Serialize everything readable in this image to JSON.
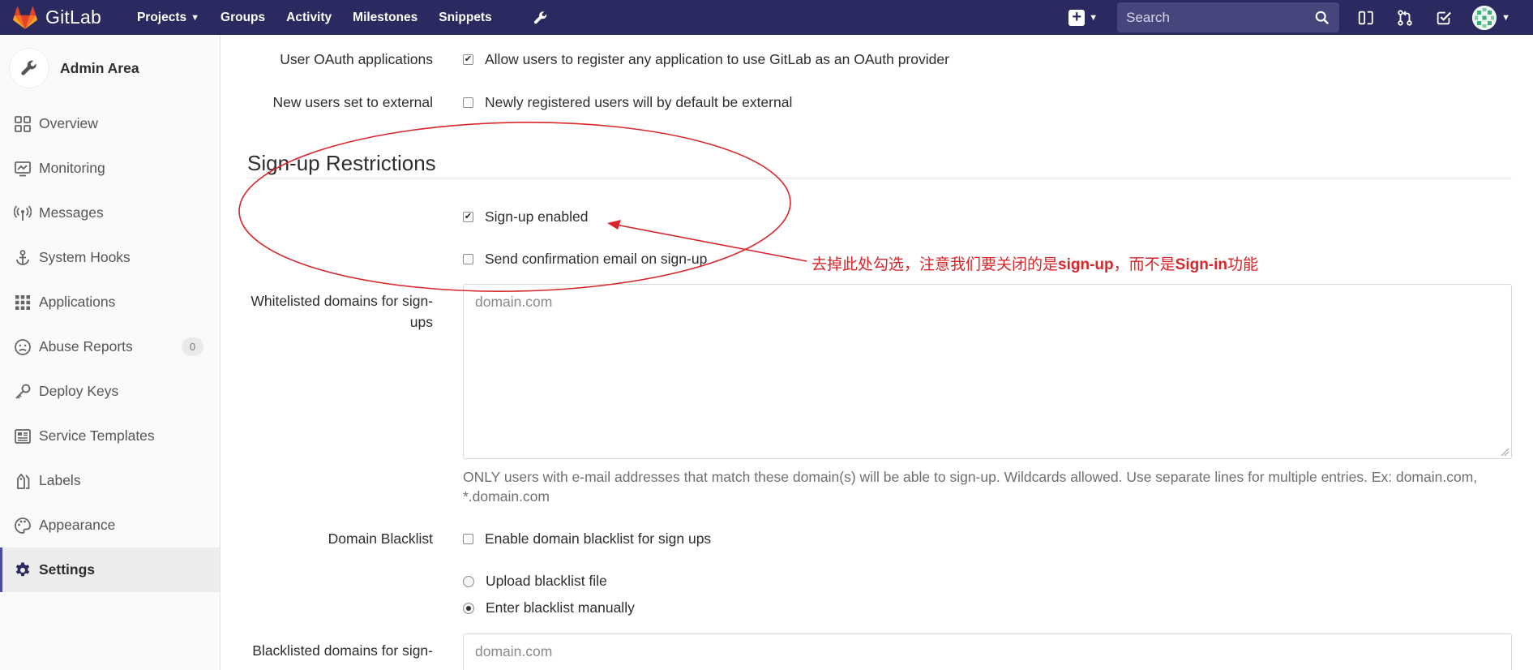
{
  "navbar": {
    "brand": "GitLab",
    "links": [
      "Projects",
      "Groups",
      "Activity",
      "Milestones",
      "Snippets"
    ],
    "search_placeholder": "Search"
  },
  "sidebar": {
    "title": "Admin Area",
    "items": [
      {
        "label": "Overview",
        "icon": "overview-icon"
      },
      {
        "label": "Monitoring",
        "icon": "monitoring-icon"
      },
      {
        "label": "Messages",
        "icon": "messages-icon"
      },
      {
        "label": "System Hooks",
        "icon": "hook-icon"
      },
      {
        "label": "Applications",
        "icon": "applications-icon"
      },
      {
        "label": "Abuse Reports",
        "icon": "abuse-icon",
        "badge": "0"
      },
      {
        "label": "Deploy Keys",
        "icon": "key-icon"
      },
      {
        "label": "Service Templates",
        "icon": "templates-icon"
      },
      {
        "label": "Labels",
        "icon": "label-icon"
      },
      {
        "label": "Appearance",
        "icon": "palette-icon"
      },
      {
        "label": "Settings",
        "icon": "gear-icon",
        "active": true
      }
    ]
  },
  "form": {
    "oauth_label": "User OAuth applications",
    "oauth_check": "Allow users to register any application to use GitLab as an OAuth provider",
    "external_label": "New users set to external",
    "external_check": "Newly registered users will by default be external",
    "section_title": "Sign-up Restrictions",
    "signup_enabled": "Sign-up enabled",
    "send_confirmation": "Send confirmation email on sign-up",
    "whitelist_label_1": "Whitelisted domains for sign-",
    "whitelist_label_2": "ups",
    "whitelist_placeholder": "domain.com",
    "whitelist_help_1": "ONLY users with e-mail addresses that match these domain(s) will be able to sign-up. Wildcards allowed. Use separate lines for multiple entries. Ex: domain.com,",
    "whitelist_help_2": "*.domain.com",
    "blacklist_label": "Domain Blacklist",
    "blacklist_check": "Enable domain blacklist for sign ups",
    "upload_radio": "Upload blacklist file",
    "manual_radio": "Enter blacklist manually",
    "blacklisted_label": "Blacklisted domains for sign-",
    "blacklisted_placeholder": "domain.com"
  },
  "annotation": {
    "text_1": "去掉此处勾选，注意我们要关闭的是",
    "text_bold_1": "sign-up",
    "text_2": "，而不是",
    "text_bold_2": "Sign-in",
    "text_3": "功能",
    "color": "#d8262a"
  },
  "colors": {
    "navbar": "#2b2a60",
    "active_accent": "#4b4ba3"
  }
}
